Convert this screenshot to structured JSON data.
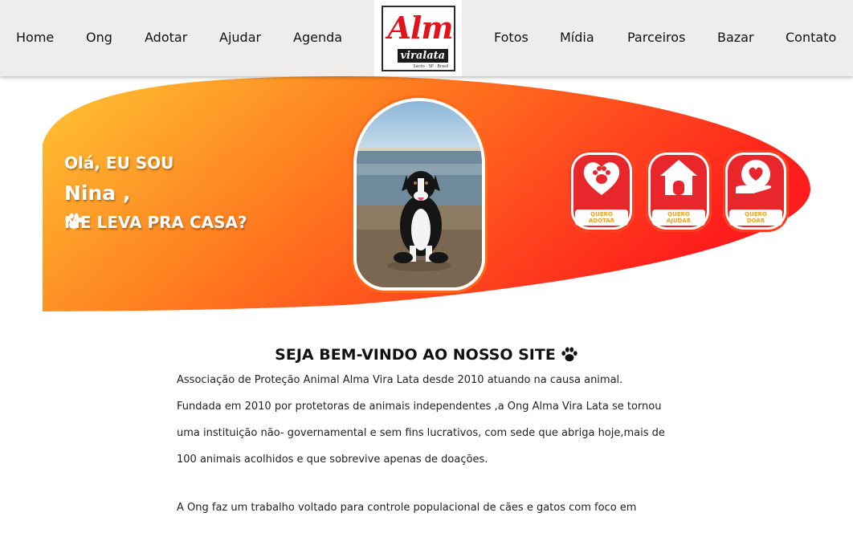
{
  "nav": {
    "left": [
      "Home",
      "Ong",
      "Adotar",
      "Ajudar",
      "Agenda"
    ],
    "right": [
      "Fotos",
      "Mídia",
      "Parceiros",
      "Bazar",
      "Contato"
    ],
    "logo": {
      "title": "Alma",
      "subtitle": "viralata",
      "tag": "Santo · SP · Brasil"
    }
  },
  "hero": {
    "greeting": "Olá, EU SOU",
    "name": "Nina ,",
    "question": "ME LEVA PRA CASA?",
    "photo_alt": "dog-photo",
    "actions": [
      {
        "line1": "QUERO",
        "line2": "ADOTAR",
        "icon": "paw-heart-icon"
      },
      {
        "line1": "QUERO",
        "line2": "AJUDAR",
        "icon": "house-icon"
      },
      {
        "line1": "QUERO",
        "line2": "DOAR",
        "icon": "hand-heart-icon"
      }
    ],
    "colors": {
      "gradient_start": "#ffc634",
      "gradient_end": "#ff1c1c",
      "button": "#e8262b"
    }
  },
  "welcome": {
    "title": "SEJA BEM-VINDO AO NOSSO SITE",
    "paragraph1": [
      "Associação de Proteção Animal Alma Vira Lata desde 2010 atuando na causa animal.",
      "Fundada em 2010 por protetoras de animais independentes ,a Ong Alma Vira Lata se tornou",
      "uma instituição não- governamental e sem fins lucrativos, com sede que abriga hoje,mais de",
      "100 animais acolhidos e que sobrevive apenas de doações."
    ],
    "paragraph2": "A Ong faz um trabalho voltado para controle populacional de cães e gatos com foco em"
  }
}
